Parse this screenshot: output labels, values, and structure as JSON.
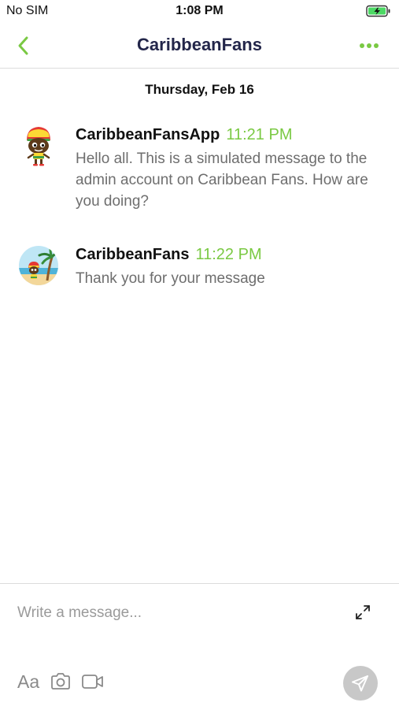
{
  "status_bar": {
    "carrier": "No SIM",
    "time": "1:08 PM"
  },
  "nav": {
    "title": "CaribbeanFans",
    "back_icon": "chevron-left-icon",
    "more_icon": "more-horizontal-icon"
  },
  "conversation": {
    "date_divider": "Thursday, Feb 16",
    "messages": [
      {
        "sender": "CaribbeanFansApp",
        "time": "11:21 PM",
        "text": "Hello all. This is a simulated message to the admin account on Caribbean Fans. How are you doing?",
        "avatar": "rasta-character-avatar"
      },
      {
        "sender": "CaribbeanFans",
        "time": "11:22 PM",
        "text": "Thank you for your message",
        "avatar": "beach-palm-avatar"
      }
    ]
  },
  "composer": {
    "placeholder": "Write a message...",
    "value": "",
    "font_label": "Aa"
  },
  "colors": {
    "accent": "#7ac943",
    "title": "#23264a",
    "message_text": "#6e6e6e",
    "send_disabled": "#c8c8c8"
  }
}
